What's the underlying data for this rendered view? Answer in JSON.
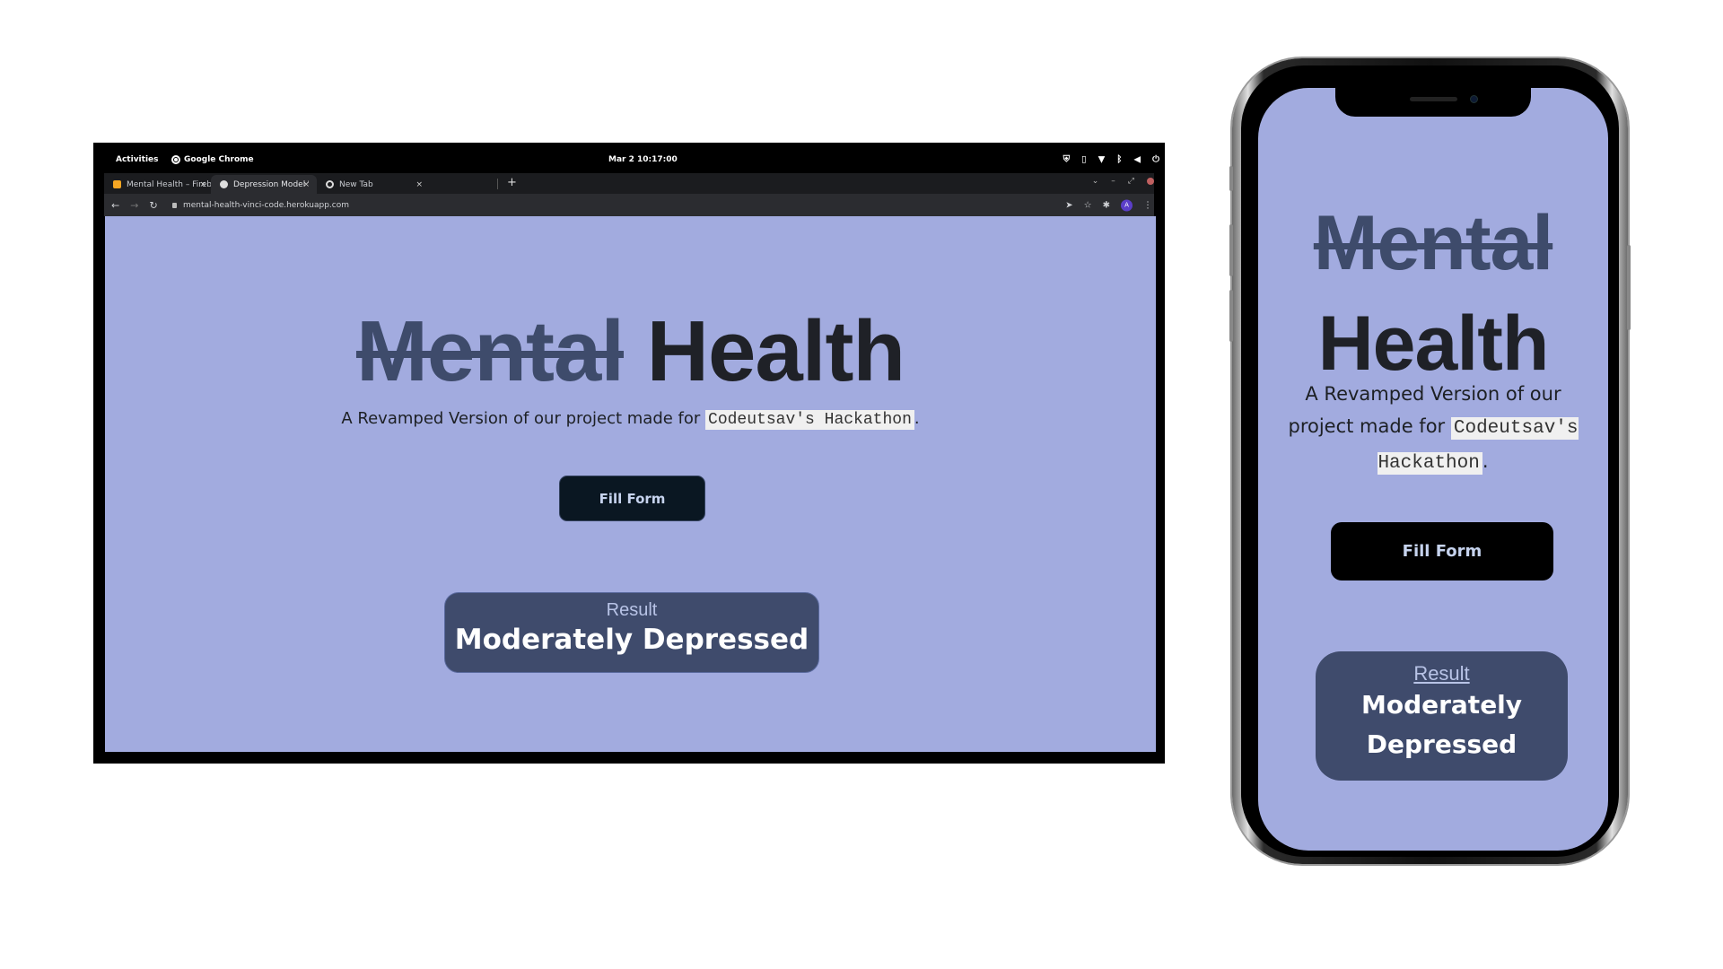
{
  "desktop": {
    "system_bar": {
      "activities": "Activities",
      "app_name": "Google Chrome",
      "clock": "Mar 2  10:17:00",
      "tray_icons": [
        "shield-icon",
        "clipboard-icon",
        "wifi-icon",
        "bluetooth-icon",
        "volume-icon",
        "power-icon"
      ]
    },
    "browser": {
      "tabs": [
        {
          "title": "Mental Health – Firebase",
          "icon": "firebase-icon",
          "active": false
        },
        {
          "title": "Depression Model WebApp",
          "icon": "globe-icon",
          "active": true
        },
        {
          "title": "New Tab",
          "icon": "chrome-icon",
          "active": false
        }
      ],
      "new_tab_symbol": "+",
      "close_symbol": "×",
      "url": "mental-health-vinci-code.herokuapp.com",
      "profile_initial": "A"
    },
    "page": {
      "title_struck": "Mental",
      "title_main": "Health",
      "subtitle_prefix": "A Revamped Version of our project made for ",
      "subtitle_code": "Codeutsav's Hackathon",
      "subtitle_suffix": ".",
      "fill_form_label": "Fill Form",
      "result_label": "Result",
      "result_value": "Moderately Depressed"
    }
  },
  "mobile": {
    "page": {
      "title_struck": "Mental",
      "title_main": "Health",
      "subtitle_prefix": "A Revamped Version of our project made for ",
      "subtitle_code": "Codeutsav's Hackathon",
      "subtitle_suffix": ".",
      "fill_form_label": "Fill Form",
      "result_label": "Result",
      "result_value": "Moderately Depressed"
    }
  },
  "colors": {
    "page_background": "#a2abdf",
    "struck_text": "#3e4b6b",
    "title_text": "#1f2127",
    "button_desktop": "#0a1722",
    "button_mobile": "#000000",
    "result_box": "#3f4b6c",
    "result_label": "#b8c3e6"
  }
}
